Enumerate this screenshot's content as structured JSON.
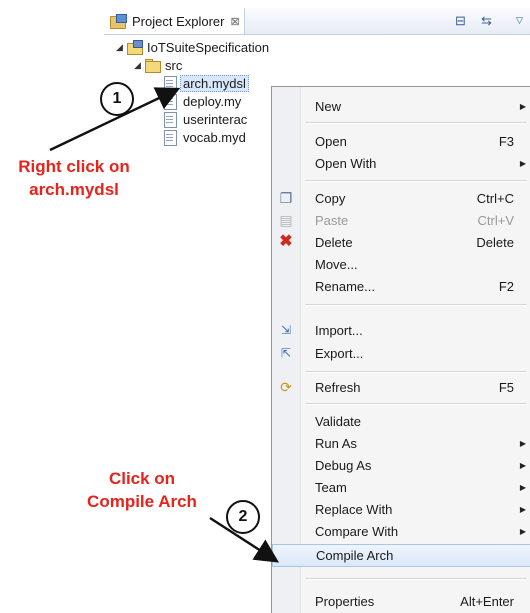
{
  "explorer": {
    "title": "Project Explorer",
    "close_glyph": "⊠",
    "toolbar": [
      "collapse-all-icon",
      "link-with-editor-icon",
      "view-menu-icon"
    ],
    "tree": {
      "project": "IoTSuiteSpecification",
      "folder": "src",
      "files": [
        "arch.mydsl",
        "deploy.my",
        "userinterac",
        "vocab.myd"
      ]
    }
  },
  "menu": {
    "items": [
      {
        "label": "New",
        "submenu": true
      },
      {
        "label": "Open",
        "shortcut": "F3"
      },
      {
        "label": "Open With",
        "submenu": true
      },
      {
        "label": "Copy",
        "shortcut": "Ctrl+C",
        "icon": "copy-icon"
      },
      {
        "label": "Paste",
        "shortcut": "Ctrl+V",
        "icon": "paste-icon",
        "disabled": true
      },
      {
        "label": "Delete",
        "shortcut": "Delete",
        "icon": "delete-icon"
      },
      {
        "label": "Move..."
      },
      {
        "label": "Rename...",
        "shortcut": "F2"
      },
      {
        "label": "Import...",
        "icon": "import-icon"
      },
      {
        "label": "Export...",
        "icon": "export-icon"
      },
      {
        "label": "Refresh",
        "shortcut": "F5",
        "icon": "refresh-icon"
      },
      {
        "label": "Validate"
      },
      {
        "label": "Run As",
        "submenu": true
      },
      {
        "label": "Debug As",
        "submenu": true
      },
      {
        "label": "Team",
        "submenu": true
      },
      {
        "label": "Replace With",
        "submenu": true
      },
      {
        "label": "Compare With",
        "submenu": true
      },
      {
        "label": "Compile Arch",
        "highlighted": true
      },
      {
        "label": "Properties",
        "shortcut": "Alt+Enter"
      }
    ]
  },
  "annotations": {
    "step1": {
      "number": "1",
      "text_line1": "Right click on",
      "text_line2": "arch.mydsl"
    },
    "step2": {
      "number": "2",
      "text_line1": "Click on",
      "text_line2": "Compile Arch"
    },
    "color": "#e8231b"
  }
}
